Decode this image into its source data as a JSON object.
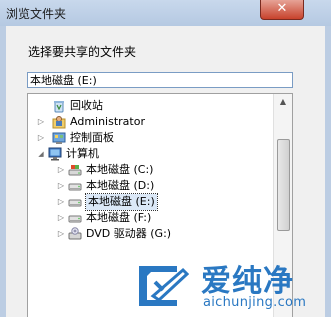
{
  "window": {
    "title": "浏览文件夹",
    "close_glyph": "✕"
  },
  "prompt": "选择要共享的文件夹",
  "path_value": "本地磁盘 (E:)",
  "tree": {
    "items": [
      {
        "label": "回收站",
        "icon": "recycle-bin-icon",
        "expander": ""
      },
      {
        "label": "Administrator",
        "icon": "user-folder-icon",
        "expander": "▷"
      },
      {
        "label": "控制面板",
        "icon": "control-panel-icon",
        "expander": "▷"
      },
      {
        "label": "计算机",
        "icon": "computer-icon",
        "expander": "◢"
      },
      {
        "label": "本地磁盘 (C:)",
        "icon": "system-drive-icon",
        "expander": "▷"
      },
      {
        "label": "本地磁盘 (D:)",
        "icon": "hard-drive-icon",
        "expander": "▷"
      },
      {
        "label": "本地磁盘 (E:)",
        "icon": "hard-drive-icon",
        "expander": "▷",
        "selected": true
      },
      {
        "label": "本地磁盘 (F:)",
        "icon": "hard-drive-icon",
        "expander": "▷"
      },
      {
        "label": "DVD 驱动器 (G:)",
        "icon": "dvd-drive-icon",
        "expander": "▷"
      }
    ]
  },
  "scrollbar": {
    "up_glyph": "▲",
    "down_glyph": "▼"
  },
  "watermark": {
    "name": "爱纯净",
    "url": "aichunjing.com"
  },
  "colors": {
    "accent": "#2a78c2",
    "selection": "#dbe8f7",
    "title_bar": "#c8d8ec"
  }
}
